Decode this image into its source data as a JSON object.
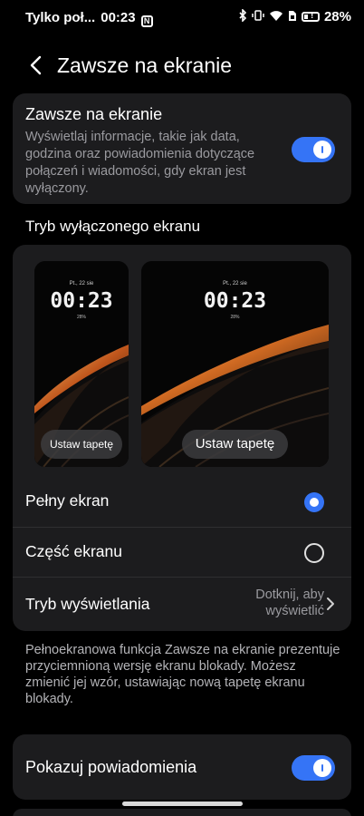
{
  "status_bar": {
    "carrier": "Tylko poł...",
    "time": "00:23",
    "nfc_icon": "N",
    "battery_percent": "28%",
    "icons": [
      "bluetooth-icon",
      "vibrate-icon",
      "wifi-icon",
      "sim-icon",
      "battery-icon"
    ]
  },
  "header": {
    "title": "Zawsze na ekranie",
    "back_icon": "chevron-left-icon"
  },
  "aod_card": {
    "title": "Zawsze na ekranie",
    "description": "Wyświetlaj informacje, takie jak data, godzina oraz powiadomienia dotyczące połączeń i wiadomości, gdy ekran jest wyłączony.",
    "toggle_on": true
  },
  "mode_section": {
    "label": "Tryb wyłączonego ekranu",
    "previews": [
      {
        "date": "Pt., 22 sie",
        "clock": "00:23",
        "battery": "28%",
        "button": "Ustaw tapetę"
      },
      {
        "date": "Pt., 22 sie",
        "clock": "00:23",
        "battery": "28%",
        "button": "Ustaw tapetę"
      }
    ],
    "options": [
      {
        "label": "Pełny ekran",
        "selected": true
      },
      {
        "label": "Część ekranu",
        "selected": false
      }
    ],
    "display_mode": {
      "label": "Tryb wyświetlania",
      "hint": "Dotknij, aby wyświetlić"
    }
  },
  "footnote": "Pełnoekranowa funkcja Zawsze na ekranie prezentuje przyciemnioną wersję ekranu blokady. Możesz zmienić jej wzór, ustawiając nową tapetę ekranu blokady.",
  "notify_card": {
    "title": "Pokazuj powiadomienia",
    "toggle_on": true
  },
  "colors": {
    "accent": "#3574f6",
    "card": "#1c1c1e",
    "background": "#000000",
    "secondary_text": "#9a9a9f"
  }
}
